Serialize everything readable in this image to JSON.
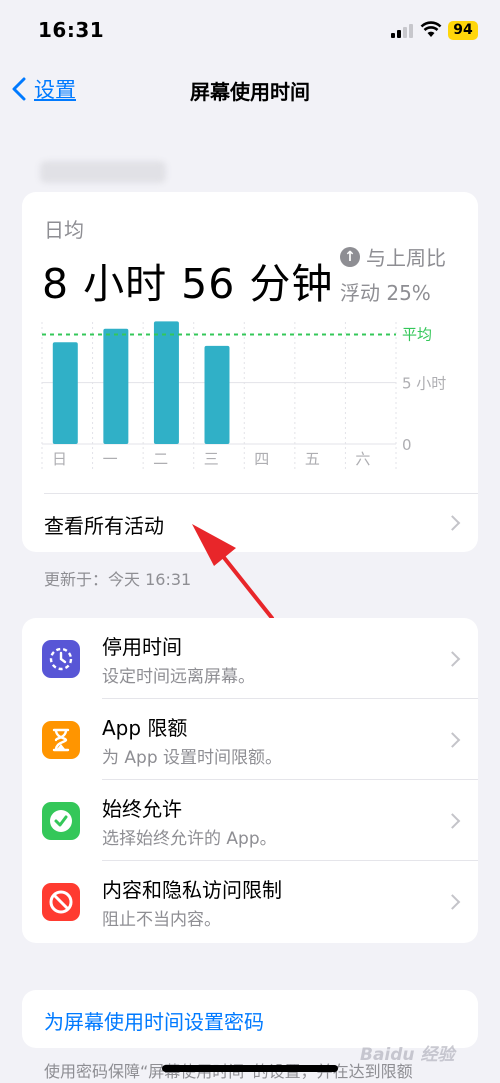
{
  "status": {
    "time": "16:31",
    "battery": "94"
  },
  "nav": {
    "back_label": "设置",
    "title": "屏幕使用时间"
  },
  "summary": {
    "daily_label": "日均",
    "daily_value": "8 小时 56 分钟",
    "compare_label": "与上周比",
    "compare_change": "浮动 25%"
  },
  "chart_data": {
    "type": "bar",
    "categories": [
      "日",
      "一",
      "二",
      "三",
      "四",
      "五",
      "六"
    ],
    "values": [
      8.3,
      9.4,
      10.0,
      8.0,
      0,
      0,
      0
    ],
    "average": 8.93,
    "avg_label": "平均",
    "ytick_labels": [
      "5 小时",
      "0"
    ],
    "yticks": [
      5,
      0
    ],
    "ylim": [
      0,
      10.6
    ],
    "colors": {
      "bar": "#30b0c7",
      "average": "#34c759",
      "grid": "#e3e3e8"
    }
  },
  "see_all_label": "查看所有活动",
  "updated": "更新于：今天 16:31",
  "menu": [
    {
      "title": "停用时间",
      "subtitle": "设定时间远离屏幕。",
      "icon": "downtime-icon",
      "color": "#5856d6"
    },
    {
      "title": "App 限额",
      "subtitle": "为 App 设置时间限额。",
      "icon": "hourglass-icon",
      "color": "#ff9500"
    },
    {
      "title": "始终允许",
      "subtitle": "选择始终允许的 App。",
      "icon": "checkmark-seal-icon",
      "color": "#34c759"
    },
    {
      "title": "内容和隐私访问限制",
      "subtitle": "阻止不当内容。",
      "icon": "restriction-icon",
      "color": "#ff3b30"
    }
  ],
  "passcode_label": "为屏幕使用时间设置密码",
  "footnote": "使用密码保障“屏幕使用时间”的设置，并在达到限额"
}
